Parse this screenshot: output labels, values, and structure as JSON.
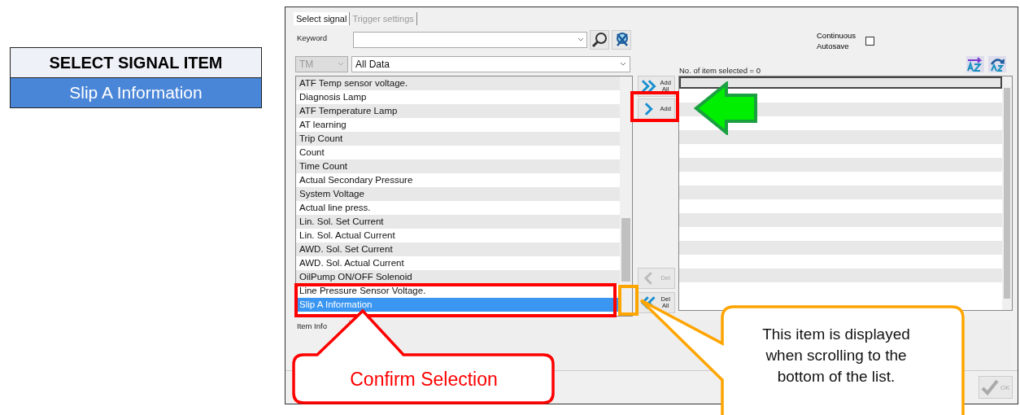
{
  "header_box": {
    "title": "SELECT SIGNAL ITEM",
    "subtitle": "Slip A Information"
  },
  "window": {
    "tabs": [
      {
        "label": "Select signal",
        "selected": true
      },
      {
        "label": "Trigger settings",
        "selected": false
      }
    ],
    "keyword": {
      "label": "Keyword"
    },
    "continuous_autosave": {
      "label": "Continuous Autosave",
      "checked": false
    },
    "module_dropdown": {
      "value": "TM",
      "disabled": true
    },
    "data_dropdown": {
      "value": "All Data",
      "disabled": false
    },
    "signal_list": [
      {
        "label": "ATF Temp sensor voltage.",
        "selected": false
      },
      {
        "label": "Diagnosis Lamp",
        "selected": false
      },
      {
        "label": "ATF Temperature Lamp",
        "selected": false
      },
      {
        "label": "AT learning",
        "selected": false
      },
      {
        "label": "Trip Count",
        "selected": false
      },
      {
        "label": "Count",
        "selected": false
      },
      {
        "label": "Time Count",
        "selected": false
      },
      {
        "label": "Actual Secondary Pressure",
        "selected": false
      },
      {
        "label": "System Voltage",
        "selected": false
      },
      {
        "label": "Actual line press.",
        "selected": false
      },
      {
        "label": "Lin. Sol. Set Current",
        "selected": false
      },
      {
        "label": "Lin. Sol. Actual Current",
        "selected": false
      },
      {
        "label": "AWD. Sol. Set Current",
        "selected": false
      },
      {
        "label": "AWD. Sol. Actual Current",
        "selected": false
      },
      {
        "label": "OilPump ON/OFF Solenoid",
        "selected": false
      },
      {
        "label": "Line Pressure Sensor Voltage.",
        "selected": false
      },
      {
        "label": "Slip A Information",
        "selected": true
      }
    ],
    "transfer_buttons": [
      {
        "label": "Add All",
        "kind": "add-all",
        "disabled": false
      },
      {
        "label": "Add",
        "kind": "add",
        "disabled": false
      },
      {
        "label": "Del",
        "kind": "del",
        "disabled": true
      },
      {
        "label": "Del All",
        "kind": "del-all",
        "disabled": false
      }
    ],
    "selected_count": "No. of item selected = 0",
    "item_info_label": "Item Info",
    "ok_button": {
      "label": "OK",
      "disabled": true
    }
  },
  "annotations": {
    "highlights": [
      {
        "kind": "add",
        "color": "#ff0000"
      },
      {
        "kind": "selection",
        "color": "#ff0000"
      },
      {
        "kind": "scroll",
        "color": "#ffa500"
      }
    ],
    "arrow": {
      "color": "#00ee00"
    },
    "callouts": [
      {
        "kind": "selection",
        "text": "Confirm Selection",
        "color": "#ff0000"
      },
      {
        "kind": "scroll",
        "text": "This item is displayed when scrolling to the bottom of the list.",
        "color": "#ffa500"
      }
    ]
  }
}
